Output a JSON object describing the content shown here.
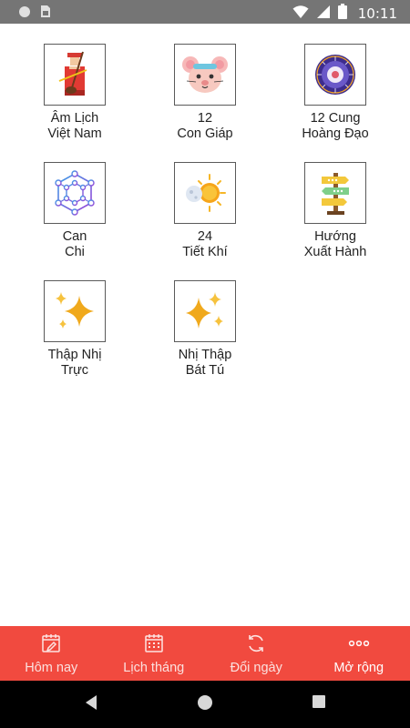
{
  "status_bar": {
    "time": "10:11",
    "icons": [
      "circle-notification-icon",
      "sim-card-icon",
      "wifi-icon",
      "signal-icon",
      "battery-icon"
    ]
  },
  "grid": {
    "items": [
      {
        "line1": "Âm Lịch",
        "line2": "Việt Nam",
        "icon": "musician-icon"
      },
      {
        "line1": "12",
        "line2": "Con Giáp",
        "icon": "rat-icon"
      },
      {
        "line1": "12 Cung",
        "line2": "Hoàng Đạo",
        "icon": "zodiac-wheel-icon"
      },
      {
        "line1": "Can",
        "line2": "Chi",
        "icon": "hexagon-network-icon"
      },
      {
        "line1": "24",
        "line2": "Tiết Khí",
        "icon": "sun-moon-icon"
      },
      {
        "line1": "Hướng",
        "line2": "Xuất Hành",
        "icon": "signpost-icon"
      },
      {
        "line1": "Thập Nhị",
        "line2": "Trực",
        "icon": "sparkle-icon"
      },
      {
        "line1": "Nhị Thập",
        "line2": "Bát Tú",
        "icon": "stars-icon"
      }
    ]
  },
  "bottom_nav": {
    "accent": "#f14a3f",
    "items": [
      {
        "label": "Hôm nay",
        "icon": "today-calendar-icon"
      },
      {
        "label": "Lịch tháng",
        "icon": "month-calendar-icon"
      },
      {
        "label": "Đổi ngày",
        "icon": "convert-date-icon"
      },
      {
        "label": "Mở rộng",
        "icon": "more-icon",
        "active": true
      }
    ]
  },
  "android_nav": [
    "back-icon",
    "home-icon",
    "recents-icon"
  ]
}
